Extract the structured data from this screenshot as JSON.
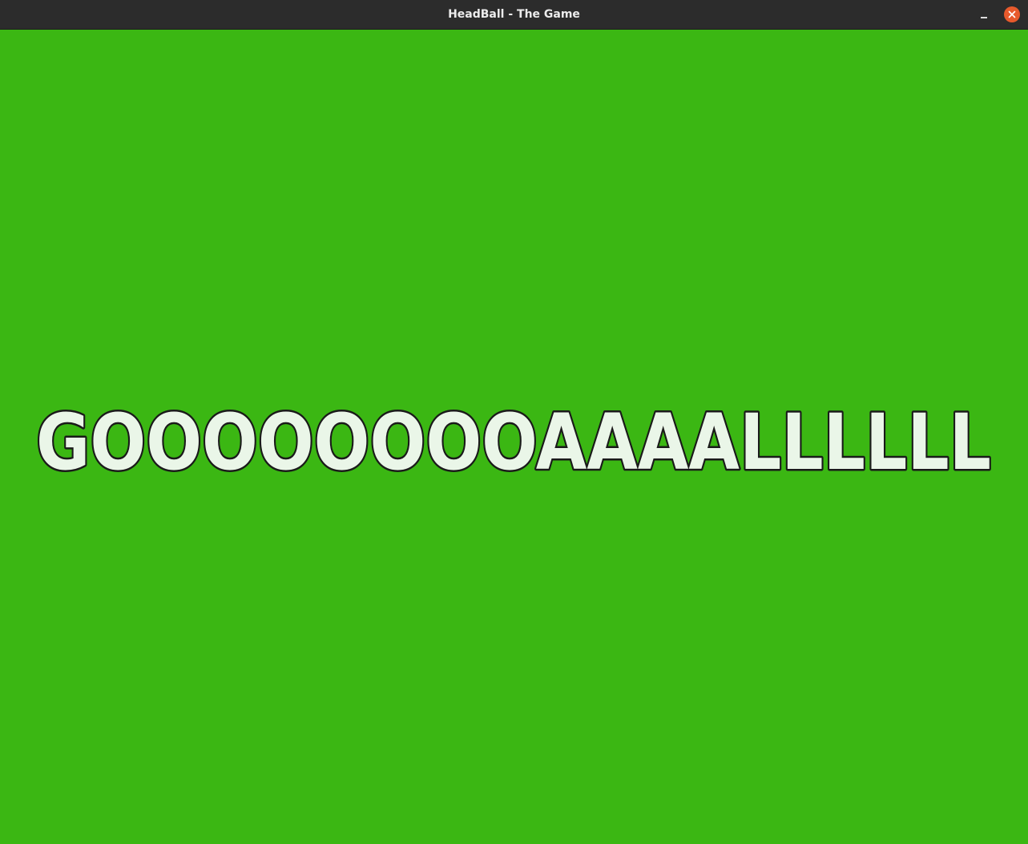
{
  "window": {
    "title": "HeadBall - The Game"
  },
  "game": {
    "message": "GOOOOOOOOAAAALLLLLL"
  },
  "colors": {
    "field": "#3bb713",
    "text_fill": "#eaf6e8",
    "text_outline": "#1a1a1a",
    "close_button": "#e85a2c"
  },
  "icons": {
    "minimize": "minimize-icon",
    "close": "close-icon"
  }
}
